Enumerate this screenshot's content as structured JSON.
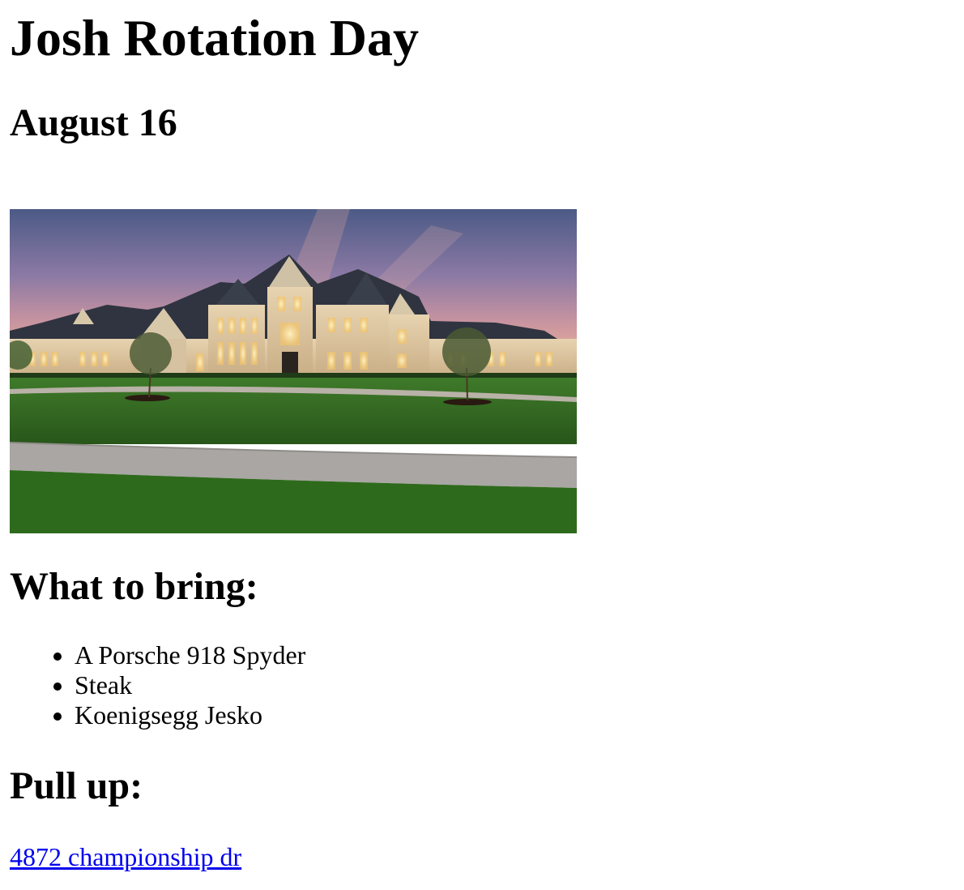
{
  "title": "Josh Rotation Day",
  "date": "August 16",
  "bring": {
    "heading": "What to bring:",
    "items": [
      "A Porsche 918 Spyder",
      "Steak",
      "Koenigsegg Jesko"
    ]
  },
  "pull_up": {
    "heading": "Pull up:",
    "address": "4872 championship dr"
  },
  "colors": {
    "link": "#0000ee",
    "text": "#000000"
  }
}
